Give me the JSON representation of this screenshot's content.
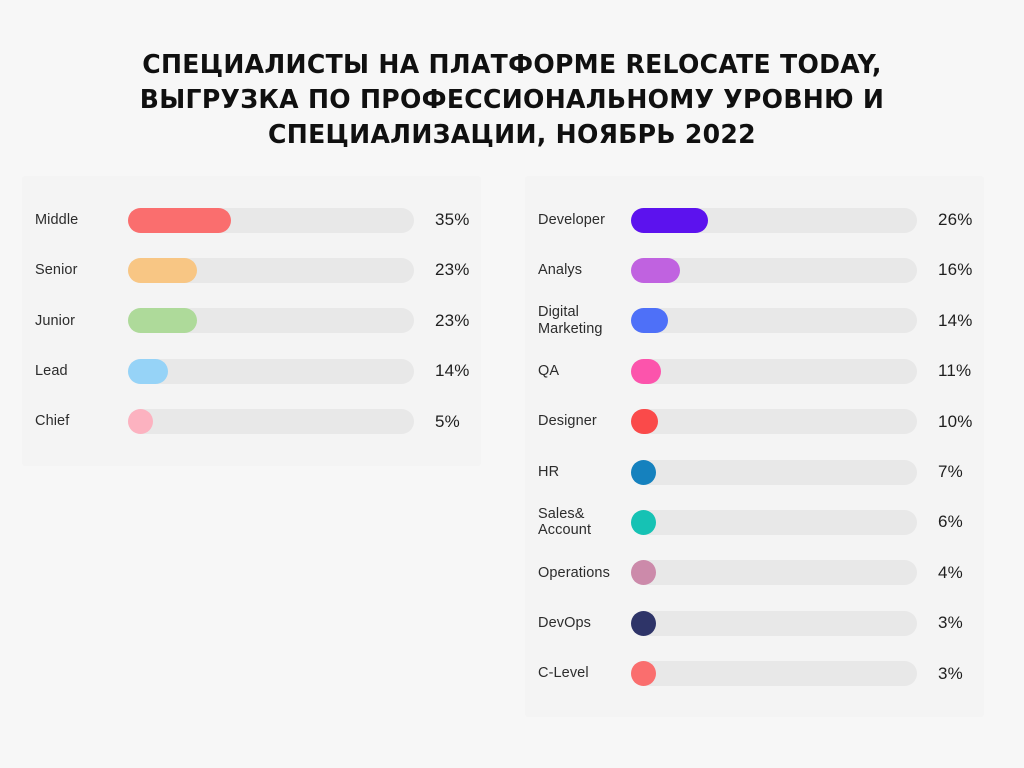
{
  "title": {
    "line1": "СПЕЦИАЛИСТЫ НА ПЛАТФОРМЕ RELOCATE TODAY,",
    "line2": "ВЫГРУЗКА ПО ПРОФЕССИОНАЛЬНОМУ УРОВНЮ И",
    "line3": "СПЕЦИАЛИЗАЦИИ, НОЯБРЬ 2022"
  },
  "colors": {
    "page_background": "#F7F7F7",
    "panel_background": "#F4F4F4",
    "track": "#E8E8E8",
    "text": "#2C2C2C",
    "title": "#101010"
  },
  "chart_data": [
    {
      "type": "bar",
      "orientation": "horizontal",
      "title": "СПЕЦИАЛИСТЫ НА ПЛАТФОРМЕ RELOCATE TODAY, ВЫГРУЗКА ПО ПРОФЕССИОНАЛЬНОМУ УРОВНЮ И СПЕЦИАЛИЗАЦИИ, НОЯБРЬ 2022",
      "panel": "seniority",
      "xlabel": "",
      "ylabel": "",
      "xlim": [
        0,
        100
      ],
      "grid": false,
      "legend": false,
      "categories": [
        "Middle",
        "Senior",
        "Junior",
        "Lead",
        "Chief"
      ],
      "values": [
        35,
        23,
        23,
        14,
        5
      ],
      "value_labels": [
        "35%",
        "23%",
        "23%",
        "14%",
        "5%"
      ],
      "bar_colors": [
        "#FA6E6E",
        "#F8C684",
        "#AEDA9A",
        "#96D3F7",
        "#FCB2C0"
      ],
      "rows": [
        {
          "label": "Middle",
          "label2": "",
          "value": 35,
          "value_label": "35%",
          "color": "#FA6E6E",
          "bar_width_pct": 36
        },
        {
          "label": "Senior",
          "label2": "",
          "value": 23,
          "value_label": "23%",
          "color": "#F8C684",
          "bar_width_pct": 24
        },
        {
          "label": "Junior",
          "label2": "",
          "value": 23,
          "value_label": "23%",
          "color": "#AEDA9A",
          "bar_width_pct": 24
        },
        {
          "label": "Lead",
          "label2": "",
          "value": 14,
          "value_label": "14%",
          "color": "#96D3F7",
          "bar_width_pct": 14
        },
        {
          "label": "Chief",
          "label2": "",
          "value": 5,
          "value_label": "5%",
          "color": "#FCB2C0",
          "bar_width_pct": 8.7
        }
      ]
    },
    {
      "type": "bar",
      "orientation": "horizontal",
      "panel": "specialization",
      "xlabel": "",
      "ylabel": "",
      "xlim": [
        0,
        100
      ],
      "grid": false,
      "legend": false,
      "categories": [
        "Developer",
        "Analys",
        "Digital Marketing",
        "QA",
        "Designer",
        "HR",
        "Sales& Account",
        "Operations",
        "DevOps",
        "C-Level"
      ],
      "values": [
        26,
        16,
        14,
        11,
        10,
        7,
        6,
        4,
        3,
        3
      ],
      "value_labels": [
        "26%",
        "16%",
        "14%",
        "11%",
        "10%",
        "7%",
        "6%",
        "4%",
        "3%",
        "3%"
      ],
      "bar_colors": [
        "#5C12EE",
        "#C062E0",
        "#4E70F8",
        "#FC54AC",
        "#FA4A4A",
        "#1581BE",
        "#16C2B4",
        "#CC8AAA",
        "#2E3468",
        "#FA6E6E"
      ],
      "rows": [
        {
          "label": "Developer",
          "label2": "",
          "value": 26,
          "value_label": "26%",
          "color": "#5C12EE",
          "bar_width_pct": 27
        },
        {
          "label": "Analys",
          "label2": "",
          "value": 16,
          "value_label": "16%",
          "color": "#C062E0",
          "bar_width_pct": 17
        },
        {
          "label": "Digital",
          "label2": "Marketing",
          "value": 14,
          "value_label": "14%",
          "color": "#4E70F8",
          "bar_width_pct": 13
        },
        {
          "label": "QA",
          "label2": "",
          "value": 11,
          "value_label": "11%",
          "color": "#FC54AC",
          "bar_width_pct": 10.5
        },
        {
          "label": "Designer",
          "label2": "",
          "value": 10,
          "value_label": "10%",
          "color": "#FA4A4A",
          "bar_width_pct": 9.5
        },
        {
          "label": "HR",
          "label2": "",
          "value": 7,
          "value_label": "7%",
          "color": "#1581BE",
          "bar_width_pct": 8.9
        },
        {
          "label": "Sales&",
          "label2": "Account",
          "value": 6,
          "value_label": "6%",
          "color": "#16C2B4",
          "bar_width_pct": 8.9
        },
        {
          "label": "Operations",
          "label2": "",
          "value": 4,
          "value_label": "4%",
          "color": "#CC8AAA",
          "bar_width_pct": 8.9
        },
        {
          "label": "DevOps",
          "label2": "",
          "value": 3,
          "value_label": "3%",
          "color": "#2E3468",
          "bar_width_pct": 8.9
        },
        {
          "label": "C-Level",
          "label2": "",
          "value": 3,
          "value_label": "3%",
          "color": "#FA6E6E",
          "bar_width_pct": 8.9
        }
      ]
    }
  ]
}
